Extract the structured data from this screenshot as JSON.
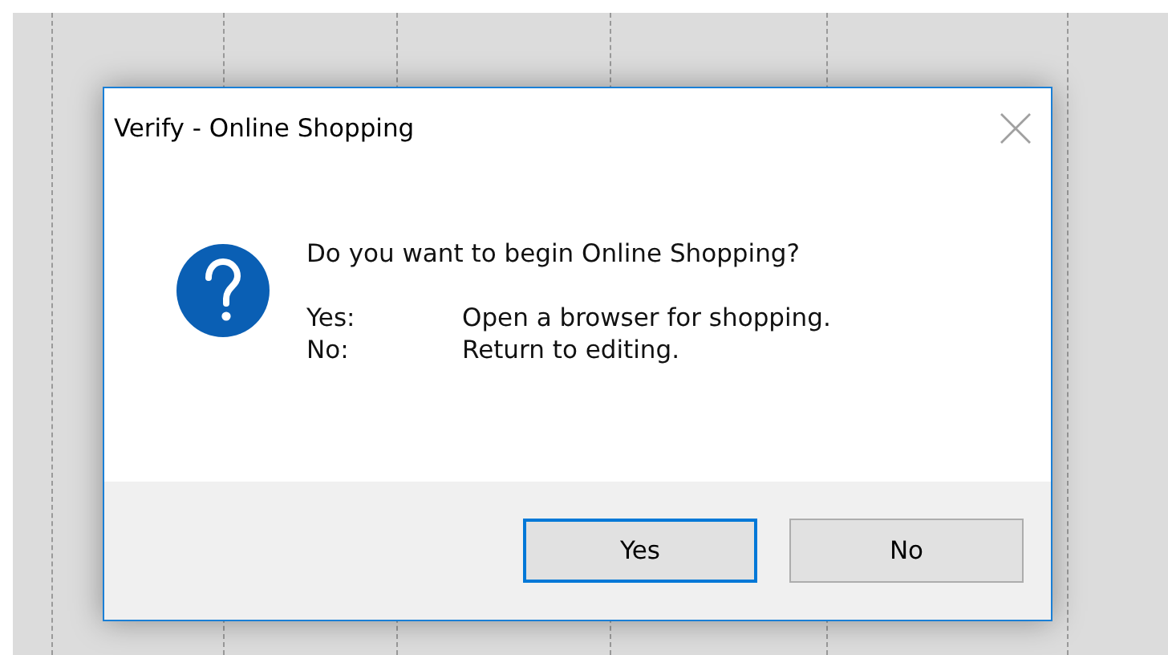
{
  "dialog": {
    "title": "Verify - Online Shopping",
    "question": "Do you want to begin Online Shopping?",
    "options": [
      {
        "key": "Yes:",
        "description": "Open a browser for shopping."
      },
      {
        "key": "No:",
        "description": "Return to editing."
      }
    ],
    "buttons": [
      {
        "label": "Yes",
        "default": true
      },
      {
        "label": "No",
        "default": false
      }
    ]
  }
}
